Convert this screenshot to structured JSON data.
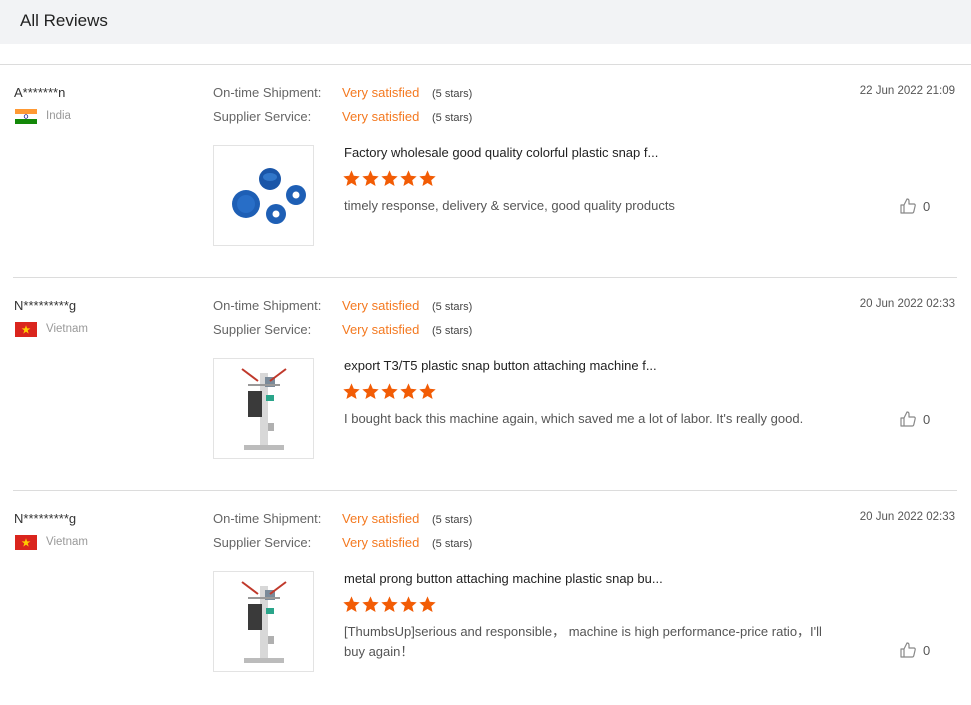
{
  "header": {
    "title": "All Reviews"
  },
  "reviews": [
    {
      "buyer": "A*******n",
      "country": "India",
      "flag": "india-flag-icon",
      "shipment_label": "On-time Shipment:",
      "shipment_value": "Very satisfied",
      "shipment_stars": "(5 stars)",
      "service_label": "Supplier Service:",
      "service_value": "Very satisfied",
      "service_stars": "(5 stars)",
      "date": "22 Jun 2022 21:09",
      "product": "Factory wholesale good quality colorful plastic snap f...",
      "rating": 5,
      "comment": "timely response, delivery & service, good quality products",
      "likes": "0",
      "image": "blue-plastic-snaps-image"
    },
    {
      "buyer": "N*********g",
      "country": "Vietnam",
      "flag": "vietnam-flag-icon",
      "shipment_label": "On-time Shipment:",
      "shipment_value": "Very satisfied",
      "shipment_stars": "(5 stars)",
      "service_label": "Supplier Service:",
      "service_value": "Very satisfied",
      "service_stars": "(5 stars)",
      "date": "20 Jun 2022 02:33",
      "product": "export T3/T5 plastic snap button attaching machine f...",
      "rating": 5,
      "comment": "I bought back this machine again, which saved me a lot of labor. It's really good.",
      "likes": "0",
      "image": "snap-button-machine-image"
    },
    {
      "buyer": "N*********g",
      "country": "Vietnam",
      "flag": "vietnam-flag-icon",
      "shipment_label": "On-time Shipment:",
      "shipment_value": "Very satisfied",
      "shipment_stars": "(5 stars)",
      "service_label": "Supplier Service:",
      "service_value": "Very satisfied",
      "service_stars": "(5 stars)",
      "date": "20 Jun 2022 02:33",
      "product": "metal prong button attaching machine plastic snap bu...",
      "rating": 5,
      "comment": "[ThumbsUp]serious and responsible， machine is high performance-price ratio，I'll buy again！",
      "likes": "0",
      "image": "snap-button-machine-image"
    }
  ],
  "colors": {
    "accent": "#f47920",
    "star": "#f25c05",
    "header_bg": "#f2f3f5",
    "divider": "#dcdcdc"
  }
}
